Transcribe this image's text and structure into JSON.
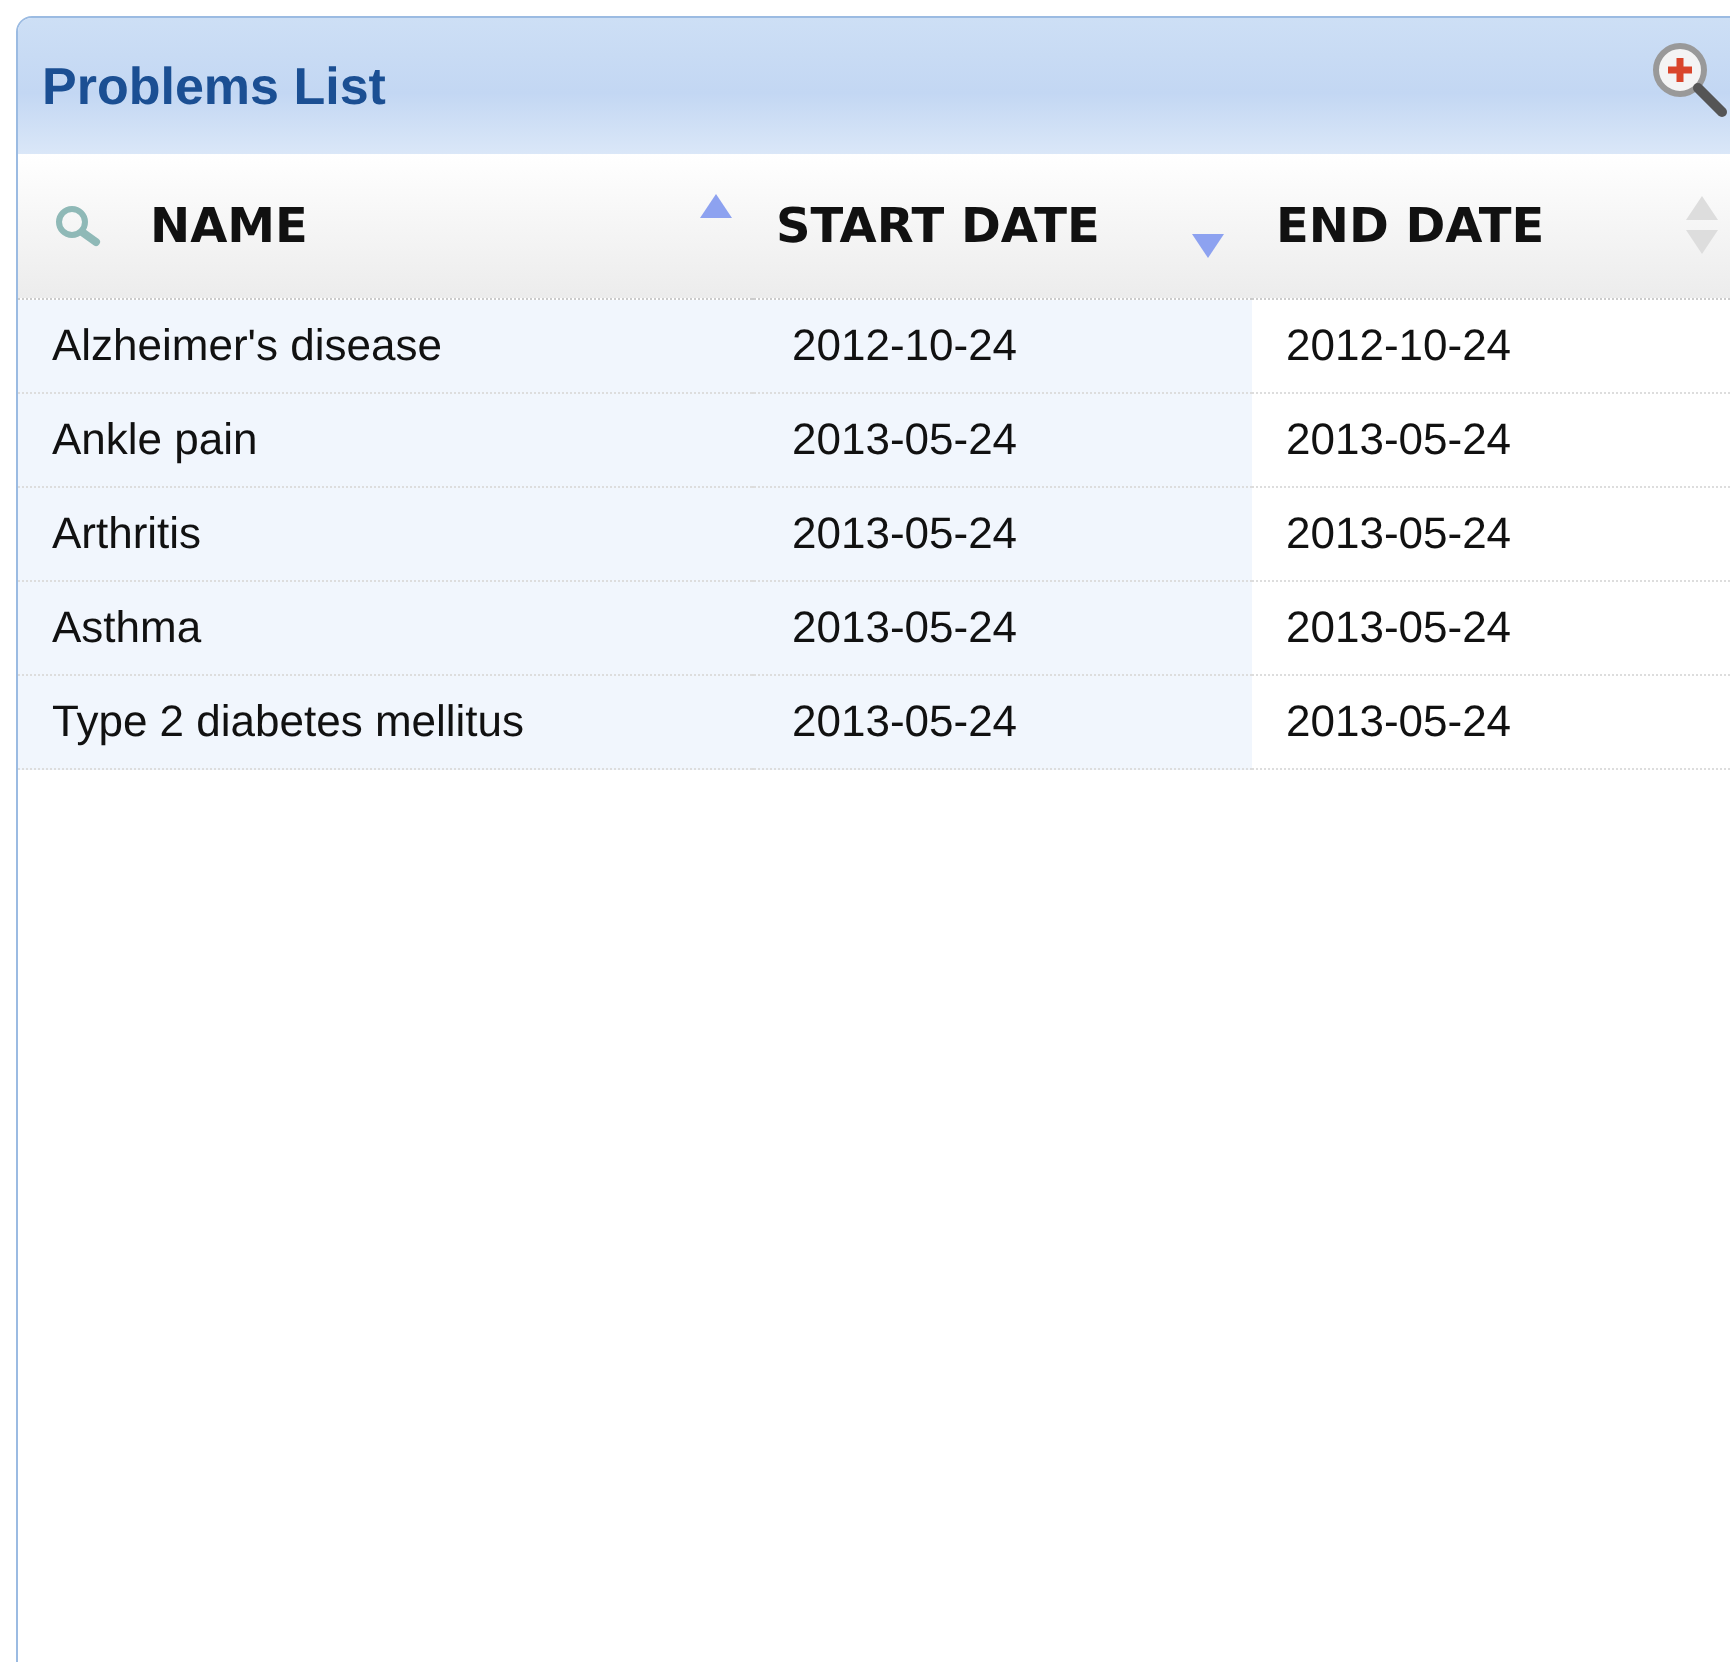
{
  "panel": {
    "title": "Problems List"
  },
  "table": {
    "columns": [
      {
        "label": "NAME",
        "sorted": true,
        "descending": false
      },
      {
        "label": "START DATE",
        "sorted": true,
        "descending": true
      },
      {
        "label": "END DATE",
        "sorted": false
      }
    ],
    "rows": [
      [
        "Alzheimer's disease",
        "2012-10-24",
        "2012-10-24"
      ],
      [
        "Ankle pain",
        "2013-05-24",
        "2013-05-24"
      ],
      [
        "Arthritis",
        "2013-05-24",
        "2013-05-24"
      ],
      [
        "Asthma",
        "2013-05-24",
        "2013-05-24"
      ],
      [
        "Type 2 diabetes mellitus",
        "2013-05-24",
        "2013-05-24"
      ]
    ]
  }
}
